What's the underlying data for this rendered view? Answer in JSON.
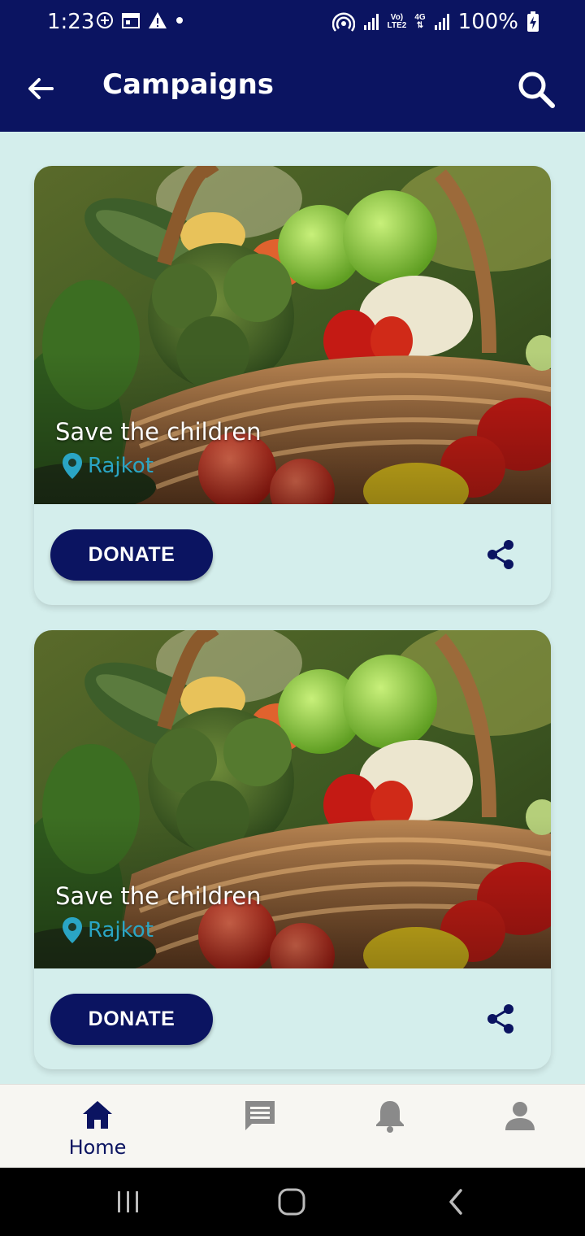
{
  "status_bar": {
    "time": "1:23",
    "battery": "100%",
    "net_top": "Vo)",
    "net_bottom": "LTE2",
    "gen": "4G"
  },
  "app_bar": {
    "title": "Campaigns",
    "back_icon": "arrow-left-icon",
    "search_icon": "search-icon"
  },
  "campaigns": [
    {
      "title": "Save the children",
      "location": "Rajkot",
      "donate_label": "DONATE"
    },
    {
      "title": "Save the children",
      "location": "Rajkot",
      "donate_label": "DONATE"
    }
  ],
  "bottom_nav": {
    "items": [
      {
        "label": "Home",
        "icon": "home-icon",
        "active": true
      },
      {
        "label": "",
        "icon": "chat-icon",
        "active": false
      },
      {
        "label": "",
        "icon": "bell-icon",
        "active": false
      },
      {
        "label": "",
        "icon": "person-icon",
        "active": false
      }
    ]
  },
  "colors": {
    "primary": "#0b1461",
    "background": "#d4eeec",
    "location": "#2aa5c4",
    "inactive_icon": "#8a8a8a"
  }
}
